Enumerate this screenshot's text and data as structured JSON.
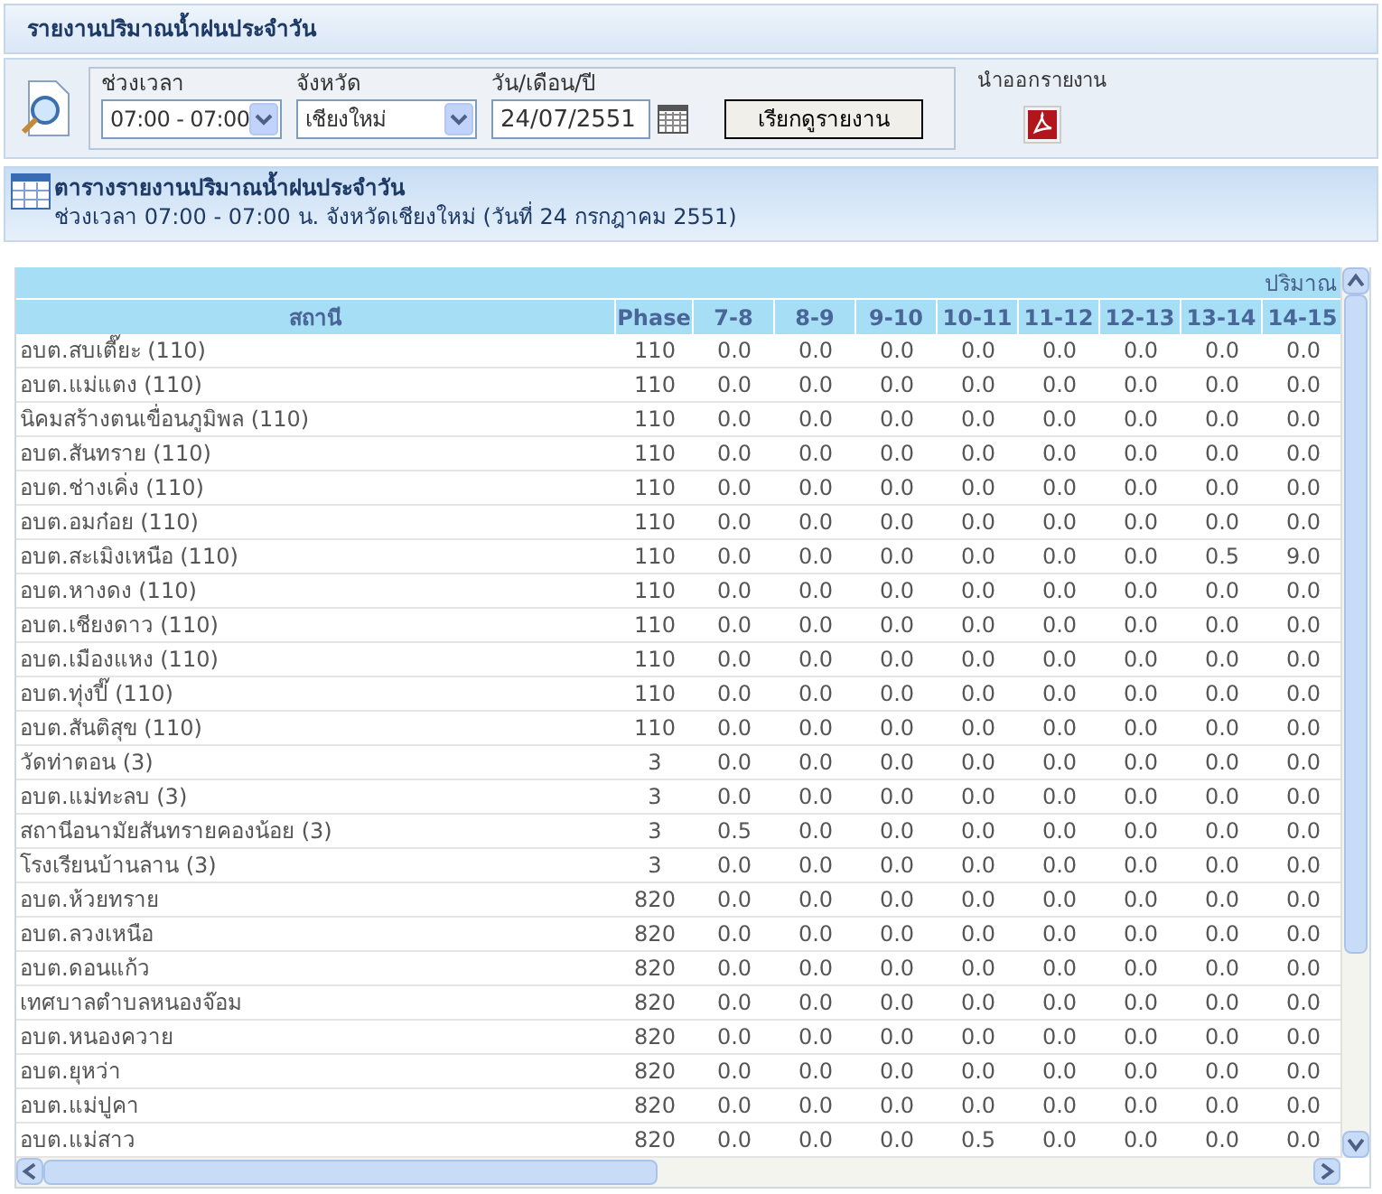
{
  "title": "รายงานปริมาณน้ำฝนประจำวัน",
  "filters": [
    {
      "label": "ช่วงเวลา",
      "kind": "select",
      "value": "07:00 - 07:00"
    },
    {
      "label": "จังหวัด",
      "kind": "select",
      "value": "เชียงใหม่"
    },
    {
      "label": "วัน/เดือน/ปี",
      "kind": "date",
      "value": "24/07/2551"
    }
  ],
  "search_button": "เรียกดูรายงาน",
  "export": {
    "label": "นำออกรายงาน"
  },
  "report": {
    "title": "ตารางรายงานปริมาณน้ำฝนประจำวัน",
    "subtitle": "ช่วงเวลา 07:00 - 07:00 น. จังหวัดเชียงใหม่ (วันที่ 24 กรกฎาคม 2551)"
  },
  "table": {
    "group_header": "ปริมาณ",
    "columns": [
      "สถานี",
      "Phase",
      "7-8",
      "8-9",
      "9-10",
      "10-11",
      "11-12",
      "12-13",
      "13-14",
      "14-15"
    ],
    "rows": [
      {
        "station": "อบต.สบเตี๊ยะ (110)",
        "phase": "110",
        "values": [
          "0.0",
          "0.0",
          "0.0",
          "0.0",
          "0.0",
          "0.0",
          "0.0",
          "0.0"
        ]
      },
      {
        "station": "อบต.แม่แตง (110)",
        "phase": "110",
        "values": [
          "0.0",
          "0.0",
          "0.0",
          "0.0",
          "0.0",
          "0.0",
          "0.0",
          "0.0"
        ]
      },
      {
        "station": "นิคมสร้างตนเขื่อนภูมิพล (110)",
        "phase": "110",
        "values": [
          "0.0",
          "0.0",
          "0.0",
          "0.0",
          "0.0",
          "0.0",
          "0.0",
          "0.0"
        ]
      },
      {
        "station": "อบต.สันทราย (110)",
        "phase": "110",
        "values": [
          "0.0",
          "0.0",
          "0.0",
          "0.0",
          "0.0",
          "0.0",
          "0.0",
          "0.0"
        ]
      },
      {
        "station": "อบต.ช่างเคิ่ง (110)",
        "phase": "110",
        "values": [
          "0.0",
          "0.0",
          "0.0",
          "0.0",
          "0.0",
          "0.0",
          "0.0",
          "0.0"
        ]
      },
      {
        "station": "อบต.อมก๋อย (110)",
        "phase": "110",
        "values": [
          "0.0",
          "0.0",
          "0.0",
          "0.0",
          "0.0",
          "0.0",
          "0.0",
          "0.0"
        ]
      },
      {
        "station": "อบต.สะเมิงเหนือ (110)",
        "phase": "110",
        "values": [
          "0.0",
          "0.0",
          "0.0",
          "0.0",
          "0.0",
          "0.0",
          "0.5",
          "9.0"
        ]
      },
      {
        "station": "อบต.หางดง (110)",
        "phase": "110",
        "values": [
          "0.0",
          "0.0",
          "0.0",
          "0.0",
          "0.0",
          "0.0",
          "0.0",
          "0.0"
        ]
      },
      {
        "station": "อบต.เชียงดาว (110)",
        "phase": "110",
        "values": [
          "0.0",
          "0.0",
          "0.0",
          "0.0",
          "0.0",
          "0.0",
          "0.0",
          "0.0"
        ]
      },
      {
        "station": "อบต.เมืองแหง (110)",
        "phase": "110",
        "values": [
          "0.0",
          "0.0",
          "0.0",
          "0.0",
          "0.0",
          "0.0",
          "0.0",
          "0.0"
        ]
      },
      {
        "station": "อบต.ทุ่งปี๊ (110)",
        "phase": "110",
        "values": [
          "0.0",
          "0.0",
          "0.0",
          "0.0",
          "0.0",
          "0.0",
          "0.0",
          "0.0"
        ]
      },
      {
        "station": "อบต.สันติสุข (110)",
        "phase": "110",
        "values": [
          "0.0",
          "0.0",
          "0.0",
          "0.0",
          "0.0",
          "0.0",
          "0.0",
          "0.0"
        ]
      },
      {
        "station": "วัดท่าตอน (3)",
        "phase": "3",
        "values": [
          "0.0",
          "0.0",
          "0.0",
          "0.0",
          "0.0",
          "0.0",
          "0.0",
          "0.0"
        ]
      },
      {
        "station": "อบต.แม่ทะลบ (3)",
        "phase": "3",
        "values": [
          "0.0",
          "0.0",
          "0.0",
          "0.0",
          "0.0",
          "0.0",
          "0.0",
          "0.0"
        ]
      },
      {
        "station": "สถานีอนามัยสันทรายคองน้อย (3)",
        "phase": "3",
        "values": [
          "0.5",
          "0.0",
          "0.0",
          "0.0",
          "0.0",
          "0.0",
          "0.0",
          "0.0"
        ]
      },
      {
        "station": "โรงเรียนบ้านลาน (3)",
        "phase": "3",
        "values": [
          "0.0",
          "0.0",
          "0.0",
          "0.0",
          "0.0",
          "0.0",
          "0.0",
          "0.0"
        ]
      },
      {
        "station": "อบต.ห้วยทราย",
        "phase": "820",
        "values": [
          "0.0",
          "0.0",
          "0.0",
          "0.0",
          "0.0",
          "0.0",
          "0.0",
          "0.0"
        ]
      },
      {
        "station": "อบต.ลวงเหนือ",
        "phase": "820",
        "values": [
          "0.0",
          "0.0",
          "0.0",
          "0.0",
          "0.0",
          "0.0",
          "0.0",
          "0.0"
        ]
      },
      {
        "station": "อบต.ดอนแก้ว",
        "phase": "820",
        "values": [
          "0.0",
          "0.0",
          "0.0",
          "0.0",
          "0.0",
          "0.0",
          "0.0",
          "0.0"
        ]
      },
      {
        "station": "เทศบาลตำบลหนองจ๊อม",
        "phase": "820",
        "values": [
          "0.0",
          "0.0",
          "0.0",
          "0.0",
          "0.0",
          "0.0",
          "0.0",
          "0.0"
        ]
      },
      {
        "station": "อบต.หนองควาย",
        "phase": "820",
        "values": [
          "0.0",
          "0.0",
          "0.0",
          "0.0",
          "0.0",
          "0.0",
          "0.0",
          "0.0"
        ]
      },
      {
        "station": "อบต.ยุหว่า",
        "phase": "820",
        "values": [
          "0.0",
          "0.0",
          "0.0",
          "0.0",
          "0.0",
          "0.0",
          "0.0",
          "0.0"
        ]
      },
      {
        "station": "อบต.แม่ปูคา",
        "phase": "820",
        "values": [
          "0.0",
          "0.0",
          "0.0",
          "0.0",
          "0.0",
          "0.0",
          "0.0",
          "0.0"
        ]
      },
      {
        "station": "อบต.แม่สาว",
        "phase": "820",
        "values": [
          "0.0",
          "0.0",
          "0.0",
          "0.5",
          "0.0",
          "0.0",
          "0.0",
          "0.0"
        ]
      }
    ]
  }
}
